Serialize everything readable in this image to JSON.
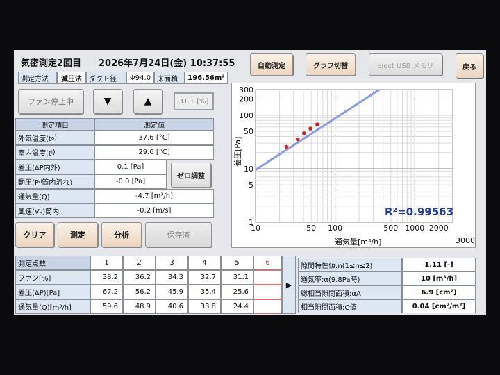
{
  "header": {
    "title": "気密測定2回目",
    "datetime": "2026年7月24日(金) 10:37:55"
  },
  "toolbar": {
    "auto_measure": "自動測定",
    "graph_switch": "グラフ切替",
    "eject_usb": "eject USB メモリ",
    "back": "戻る"
  },
  "conditions": {
    "method_label": "測定方法",
    "method_value": "減圧法",
    "duct_label": "ダクト径",
    "duct_value": "Φ94.0",
    "floor_label": "床面積",
    "floor_value": "196.56m²"
  },
  "fan_controls": {
    "fan_stop": "ファン停止中",
    "down_glyph": "▼",
    "up_glyph": "▲",
    "fan_percent": "31.1 [%]"
  },
  "measure_table": {
    "header_item": "測定項目",
    "header_value": "測定値",
    "rows": [
      {
        "label": "外気温度(t",
        "sub": "o",
        "tail": ")",
        "value": "37.6 [°C]"
      },
      {
        "label": "室内温度(t",
        "sub": "i",
        "tail": ")",
        "value": "29.6 [°C]"
      },
      {
        "label": "差圧(ΔP内外)",
        "sub": "",
        "tail": "",
        "value": "0.1 [Pa]"
      },
      {
        "label": "動圧(P",
        "sub": "d",
        "tail": "筒内流れ)",
        "value": "-0.0 [Pa]"
      },
      {
        "label": "通気量(Q)",
        "sub": "",
        "tail": "",
        "value": "-4.7 [m³/h]"
      },
      {
        "label": "風速(V",
        "sub": "d",
        "tail": ")筒内",
        "value": "-0.2 [m/s]"
      }
    ],
    "zero_adjust": "ゼロ調整"
  },
  "actions": {
    "clear": "クリア",
    "measure": "測定",
    "analyze": "分析",
    "saved": "保存済"
  },
  "points_table": {
    "header_label": "測定点数",
    "columns": [
      "1",
      "2",
      "3",
      "4",
      "5",
      "6"
    ],
    "rows": [
      {
        "label": "ファン[%]",
        "values": [
          "38.2",
          "36.2",
          "34.3",
          "32.7",
          "31.1",
          ""
        ]
      },
      {
        "label": "差圧(ΔP)[Pa]",
        "values": [
          "67.2",
          "56.2",
          "45.9",
          "35.4",
          "25.6",
          ""
        ]
      },
      {
        "label": "通気量(Q)[m³/h]",
        "values": [
          "59.6",
          "48.9",
          "40.6",
          "33.8",
          "24.4",
          ""
        ]
      }
    ],
    "arrow_glyph": "▶"
  },
  "results": [
    {
      "label": "隙間特性値:n(1≤n≤2)",
      "value": "1.11 [-]"
    },
    {
      "label": "通気率:α(9.8Pa時)",
      "value": "10 [m³/h]"
    },
    {
      "label": "総相当隙間面積:αA",
      "value": "6.9 [cm²]"
    },
    {
      "label": "相当隙間面積:C値",
      "value": "0.04 [cm²/m²]"
    }
  ],
  "chart_data": {
    "type": "scatter",
    "xlabel": "通気量[m³/h]",
    "ylabel": "差圧[Pa]",
    "x_scale": "log",
    "y_scale": "log",
    "xlim": [
      10,
      3000
    ],
    "ylim": [
      1,
      300
    ],
    "x_ticks": [
      10,
      50,
      100,
      500,
      1000,
      2000,
      3000
    ],
    "y_ticks": [
      1,
      5,
      10,
      50,
      100,
      200,
      300
    ],
    "annotation": "R²=0.99563",
    "points": [
      {
        "x": 24.4,
        "y": 25.6
      },
      {
        "x": 33.8,
        "y": 35.4
      },
      {
        "x": 40.6,
        "y": 45.9
      },
      {
        "x": 48.9,
        "y": 56.2
      },
      {
        "x": 59.6,
        "y": 67.2
      }
    ],
    "fit_line": {
      "x": [
        10,
        360
      ],
      "y": [
        9.5,
        300
      ]
    },
    "grid": true,
    "colors": {
      "points": "#cc2222",
      "fit": "#8a9be0",
      "annotation": "#1f3a9a"
    }
  }
}
